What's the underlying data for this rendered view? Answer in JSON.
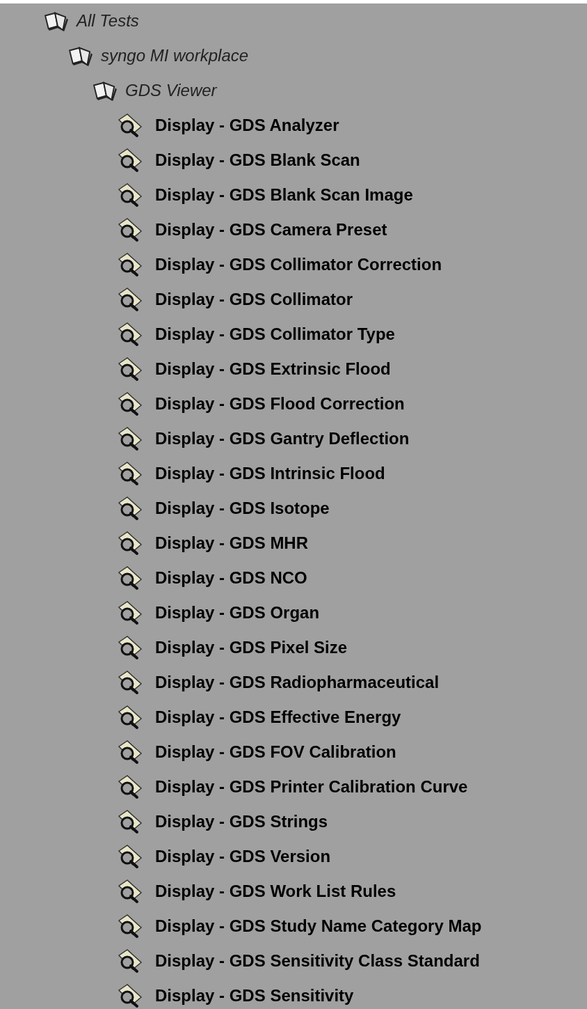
{
  "tree": [
    {
      "label": "All Tests",
      "kind": "suite",
      "children": [
        {
          "label": "syngo MI workplace",
          "kind": "suite",
          "children": [
            {
              "label": "GDS Viewer",
              "kind": "suite",
              "children": [
                {
                  "label": "Display - GDS Analyzer",
                  "kind": "test"
                },
                {
                  "label": "Display - GDS Blank Scan",
                  "kind": "test"
                },
                {
                  "label": "Display - GDS Blank Scan Image",
                  "kind": "test"
                },
                {
                  "label": "Display - GDS Camera Preset",
                  "kind": "test"
                },
                {
                  "label": "Display - GDS Collimator Correction",
                  "kind": "test"
                },
                {
                  "label": "Display - GDS Collimator",
                  "kind": "test"
                },
                {
                  "label": "Display - GDS Collimator Type",
                  "kind": "test"
                },
                {
                  "label": "Display - GDS Extrinsic Flood",
                  "kind": "test"
                },
                {
                  "label": "Display - GDS Flood Correction",
                  "kind": "test"
                },
                {
                  "label": "Display - GDS Gantry Deflection",
                  "kind": "test"
                },
                {
                  "label": "Display - GDS Intrinsic Flood",
                  "kind": "test"
                },
                {
                  "label": "Display - GDS Isotope",
                  "kind": "test"
                },
                {
                  "label": "Display - GDS MHR",
                  "kind": "test"
                },
                {
                  "label": "Display - GDS NCO",
                  "kind": "test"
                },
                {
                  "label": "Display - GDS Organ",
                  "kind": "test"
                },
                {
                  "label": "Display - GDS Pixel Size",
                  "kind": "test"
                },
                {
                  "label": "Display - GDS Radiopharmaceutical",
                  "kind": "test"
                },
                {
                  "label": "Display - GDS Effective Energy",
                  "kind": "test"
                },
                {
                  "label": "Display - GDS FOV Calibration",
                  "kind": "test"
                },
                {
                  "label": "Display - GDS Printer Calibration Curve",
                  "kind": "test"
                },
                {
                  "label": "Display - GDS Strings",
                  "kind": "test"
                },
                {
                  "label": "Display - GDS Version",
                  "kind": "test"
                },
                {
                  "label": "Display - GDS Work List Rules",
                  "kind": "test"
                },
                {
                  "label": "Display - GDS Study Name Category Map",
                  "kind": "test"
                },
                {
                  "label": "Display - GDS Sensitivity Class Standard",
                  "kind": "test"
                },
                {
                  "label": "Display - GDS Sensitivity",
                  "kind": "test"
                }
              ]
            }
          ]
        }
      ]
    }
  ]
}
